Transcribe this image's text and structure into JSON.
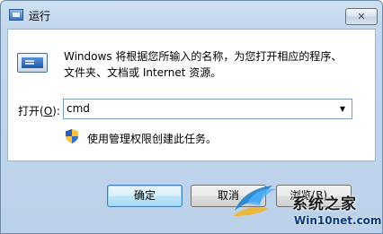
{
  "window": {
    "title": "运行",
    "close_glyph": "✕"
  },
  "content": {
    "description": "Windows 将根据您所输入的名称，为您打开相应的程序、文件夹、文档或 Internet 资源。",
    "open_label_prefix": "打开(",
    "open_label_key": "O",
    "open_label_suffix": "):",
    "command_value": "cmd",
    "admin_note": "使用管理权限创建此任务。"
  },
  "buttons": {
    "ok": "确定",
    "cancel": "取消",
    "browse": "浏览(B)..."
  },
  "watermark": {
    "title": "系统之家",
    "url": "Win10net.com"
  },
  "icons": {
    "app": "run-program-icon",
    "shield": "uac-shield-icon",
    "dropdown": "chevron-down-icon",
    "logo": "site-logo-icon"
  }
}
